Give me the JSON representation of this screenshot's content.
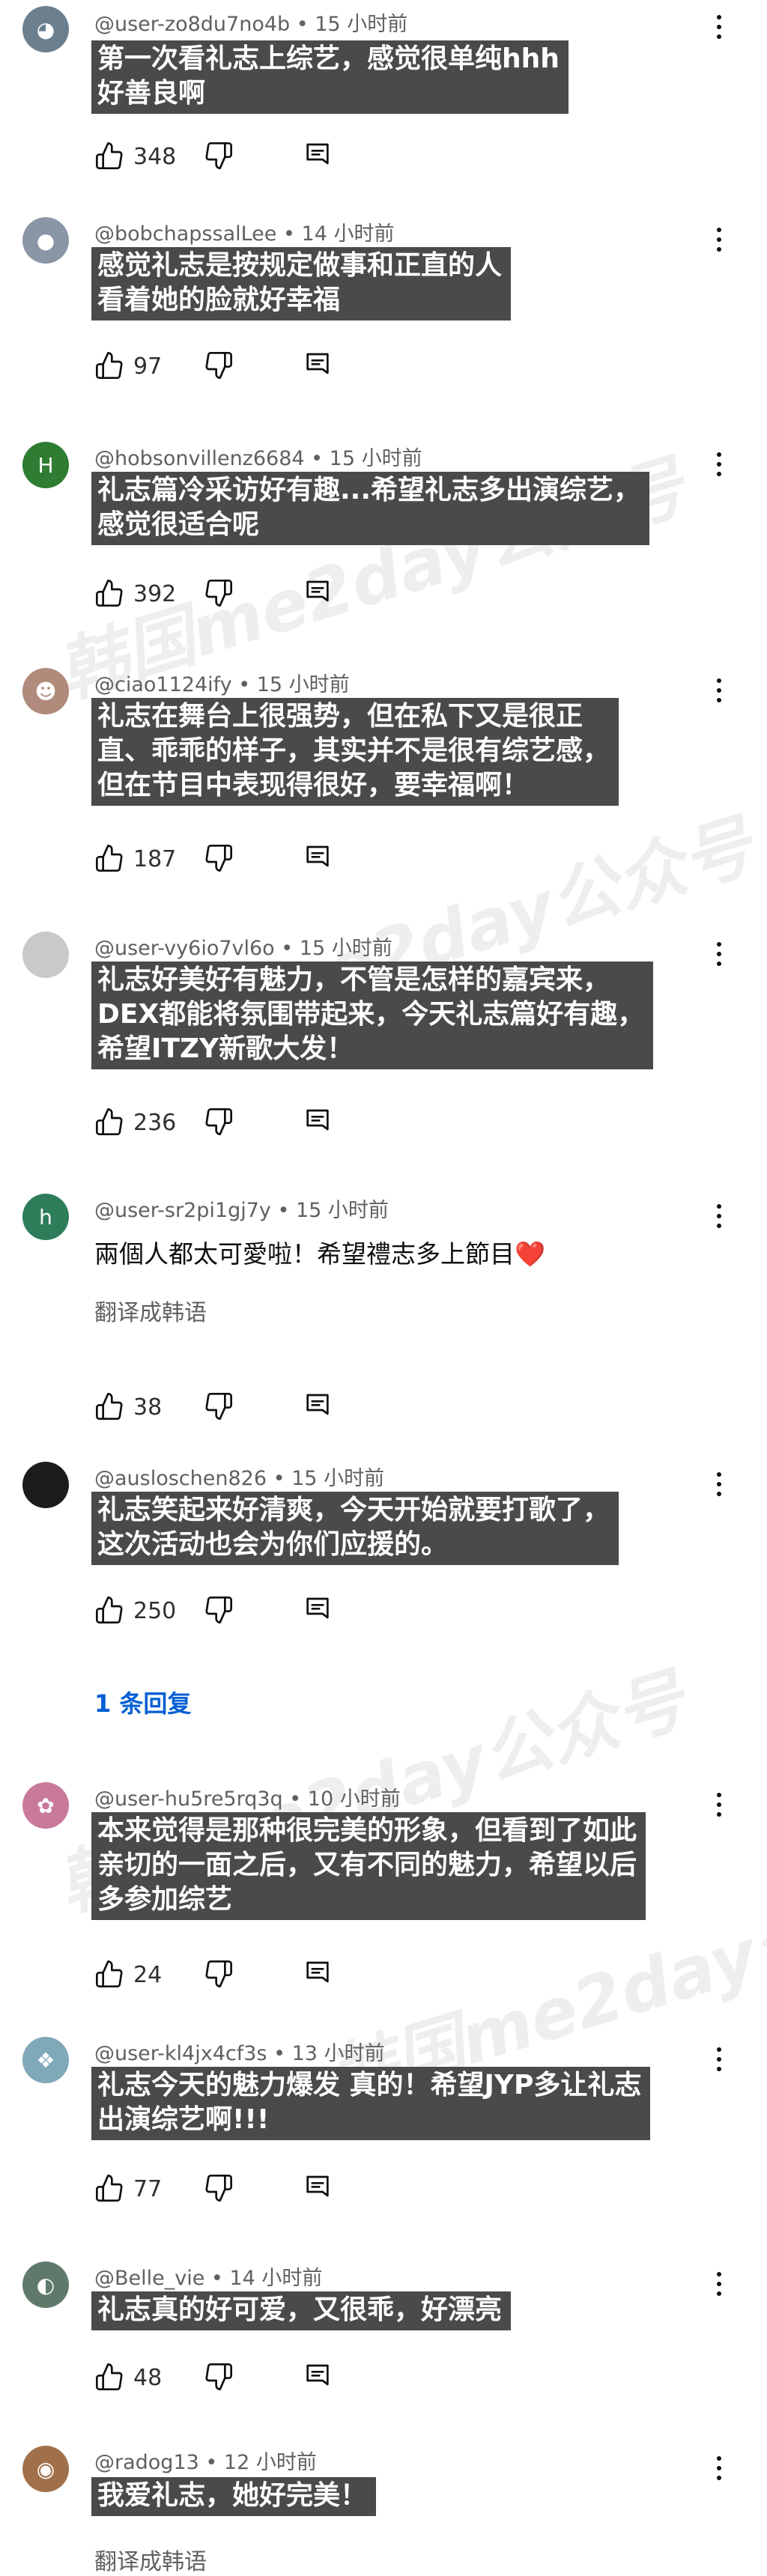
{
  "comments": [
    {
      "author": "@user-zo8du7no4b",
      "time": "15 小时前",
      "lines": [
        "第一次看礼志上综艺，感觉很单纯hhh",
        "好善良啊"
      ],
      "likes": "348",
      "avatar_color": "#6b7f8f"
    },
    {
      "author": "@bobchapssalLee",
      "time": "14 小时前",
      "lines": [
        "感觉礼志是按规定做事和正直的人",
        "看着她的脸就好幸福"
      ],
      "likes": "97",
      "avatar_color": "#8a96a6"
    },
    {
      "author": "@hobsonvillenz6684",
      "time": "15 小时前",
      "lines": [
        "礼志篇冷采访好有趣...希望礼志多出演综艺，",
        "感觉很适合呢"
      ],
      "likes": "392",
      "avatar_color": "#2e7d32",
      "avatar_letter": "H"
    },
    {
      "author": "@ciao1124ify",
      "time": "15 小时前",
      "lines": [
        "礼志在舞台上很强势，但在私下又是很正",
        "直、乖乖的样子，其实并不是很有综艺感，",
        "但在节目中表现得很好，要幸福啊！"
      ],
      "likes": "187",
      "avatar_color": "#b08a7a"
    },
    {
      "author": "@user-vy6io7vl6o",
      "time": "15 小时前",
      "lines": [
        "礼志好美好有魅力，不管是怎样的嘉宾来，",
        "DEX都能将氛围带起来，今天礼志篇好有趣，",
        "希望ITZY新歌大发！"
      ],
      "likes": "236",
      "avatar_color": "#c9c9c9"
    },
    {
      "author": "@user-sr2pi1gj7y",
      "time": "15 小时前",
      "text": "兩個人都太可愛啦！希望禮志多上節目",
      "heart": "❤️",
      "translate": "翻译成韩语",
      "likes": "38",
      "avatar_color": "#2e7d5a",
      "avatar_letter": "h"
    },
    {
      "author": "@ausloschen826",
      "time": "15 小时前",
      "lines": [
        "礼志笑起来好清爽，今天开始就要打歌了，",
        "这次活动也会为你们应援的。"
      ],
      "likes": "250",
      "avatar_color": "#1c1c1c",
      "replies": "1 条回复"
    },
    {
      "author": "@user-hu5re5rq3q",
      "time": "10 小时前",
      "lines": [
        "本来觉得是那种很完美的形象，但看到了如此",
        "亲切的一面之后，又有不同的魅力，希望以后",
        "多参加综艺"
      ],
      "likes": "24",
      "avatar_color": "#c97a9a"
    },
    {
      "author": "@user-kl4jx4cf3s",
      "time": "13 小时前",
      "lines": [
        "礼志今天的魅力爆发 真的！希望JYP多让礼志",
        "出演综艺啊!!!"
      ],
      "likes": "77",
      "avatar_color": "#7fa8b8"
    },
    {
      "author": "@Belle_vie",
      "time": "14 小时前",
      "lines": [
        "礼志真的好可爱，又很乖，好漂亮"
      ],
      "likes": "48",
      "avatar_color": "#5f7a6a"
    },
    {
      "author": "@radog13",
      "time": "12 小时前",
      "lines": [
        "我爱礼志，她好完美！"
      ],
      "translate": "翻译成韩语",
      "avatar_color": "#a0704a"
    }
  ],
  "watermark": "韩国me2day公众号"
}
